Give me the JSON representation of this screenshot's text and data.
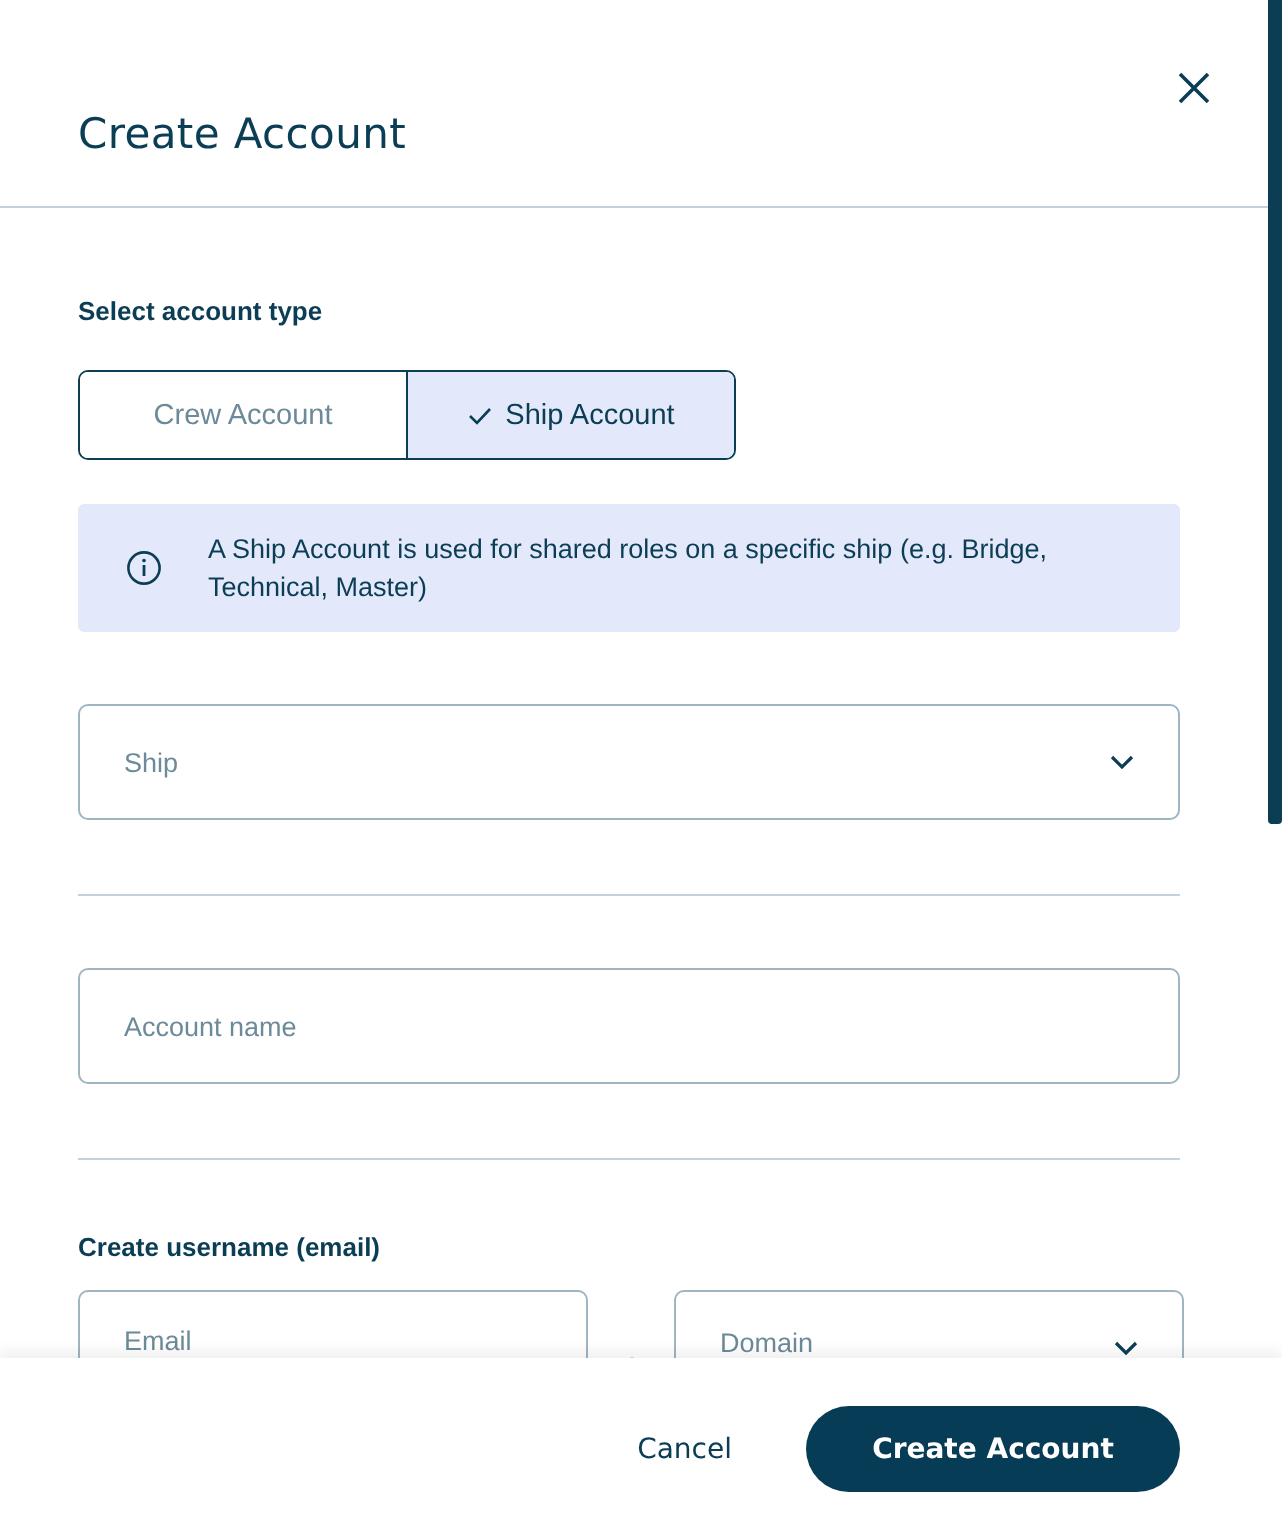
{
  "dialog": {
    "title": "Create Account"
  },
  "account_type": {
    "label": "Select account type",
    "options": [
      {
        "label": "Crew Account",
        "selected": false
      },
      {
        "label": "Ship Account",
        "selected": true
      }
    ]
  },
  "info": {
    "text": "A Ship Account is used for shared roles on a specific ship (e.g. Bridge, Technical, Master)"
  },
  "ship_select": {
    "placeholder": "Ship"
  },
  "account_name": {
    "placeholder": "Account name"
  },
  "username": {
    "label": "Create username (email)",
    "email_placeholder": "Email",
    "domain_placeholder": "Domain"
  },
  "footer": {
    "cancel": "Cancel",
    "submit": "Create Account"
  }
}
